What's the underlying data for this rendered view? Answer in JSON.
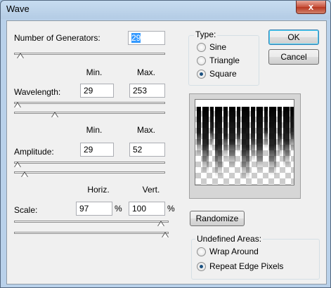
{
  "window": {
    "title": "Wave",
    "close_glyph": "x"
  },
  "generators": {
    "label": "Number of Generators:",
    "value": "29",
    "slider_fraction": 0.02
  },
  "headers": {
    "min": "Min.",
    "max": "Max.",
    "horiz": "Horiz.",
    "vert": "Vert."
  },
  "wavelength": {
    "label": "Wavelength:",
    "min": "29",
    "max": "253",
    "min_fraction": 0.0,
    "max_fraction": 0.26
  },
  "amplitude": {
    "label": "Amplitude:",
    "min": "29",
    "max": "52",
    "min_fraction": 0.0,
    "max_fraction": 0.05
  },
  "scale": {
    "label": "Scale:",
    "horiz": "97",
    "vert": "100",
    "unit": "%",
    "horiz_fraction": 0.97,
    "vert_fraction": 1.0
  },
  "type": {
    "title": "Type:",
    "options": [
      "Sine",
      "Triangle",
      "Square"
    ],
    "selected": "Square"
  },
  "buttons": {
    "ok": "OK",
    "cancel": "Cancel",
    "randomize": "Randomize"
  },
  "undefined_areas": {
    "title": "Undefined Areas:",
    "options": [
      "Wrap Around",
      "Repeat Edge Pixels"
    ],
    "selected": "Repeat Edge Pixels"
  }
}
